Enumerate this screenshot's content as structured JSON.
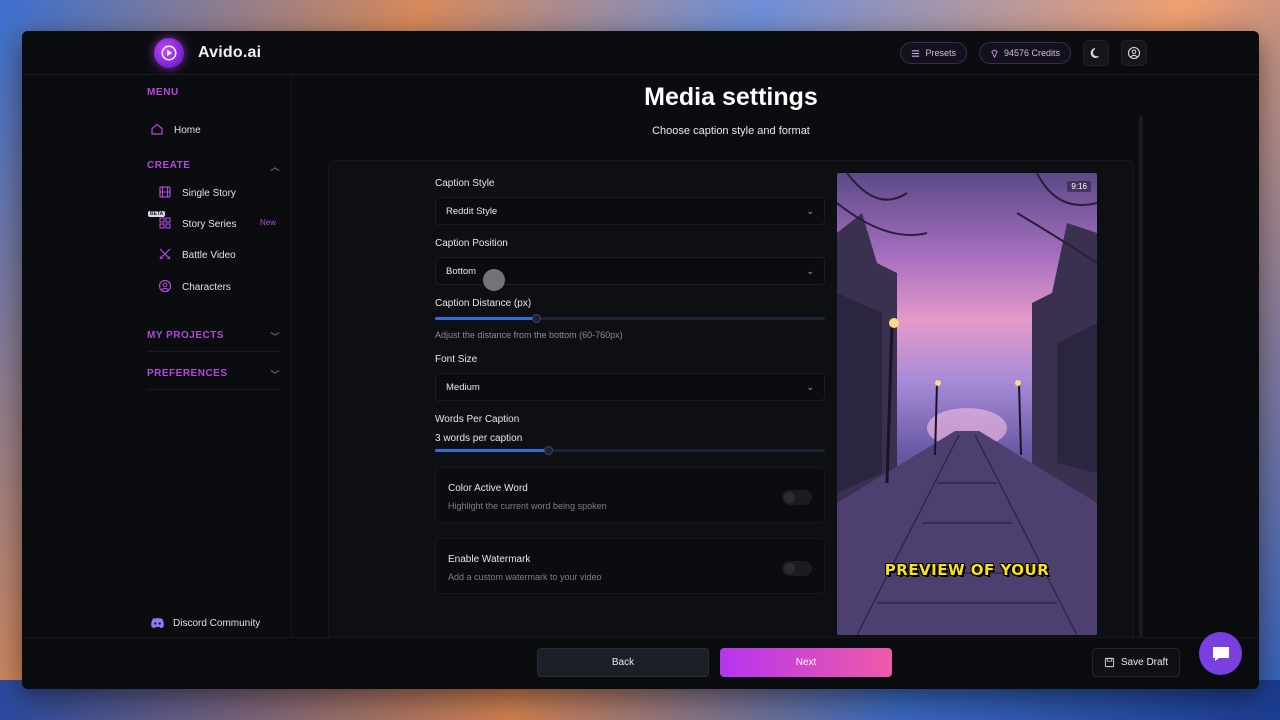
{
  "app": {
    "brand": "Avido.ai"
  },
  "topbar": {
    "presets_label": "Presets",
    "credits_label": "94576 Credits"
  },
  "sidebar": {
    "menu_label": "MENU",
    "home": "Home",
    "create_label": "CREATE",
    "items": [
      {
        "label": "Single Story"
      },
      {
        "label": "Story Series",
        "badge": "New",
        "tag": "BETA"
      },
      {
        "label": "Battle Video"
      },
      {
        "label": "Characters"
      }
    ],
    "my_projects_label": "MY PROJECTS",
    "preferences_label": "PREFERENCES",
    "discord_label": "Discord Community"
  },
  "page": {
    "title": "Media settings",
    "subtitle": "Choose caption style and format"
  },
  "form": {
    "caption_style": {
      "label": "Caption Style",
      "value": "Reddit Style"
    },
    "caption_position": {
      "label": "Caption Position",
      "value": "Bottom"
    },
    "caption_distance": {
      "label": "Caption Distance (px)",
      "hint": "Adjust the distance from the bottom (60-760px)",
      "fraction": 0.26
    },
    "font_size": {
      "label": "Font Size",
      "value": "Medium"
    },
    "words_per_caption": {
      "label": "Words Per Caption",
      "value_text": "3 words per caption",
      "fraction": 0.29
    },
    "color_active_word": {
      "title": "Color Active Word",
      "desc": "Highlight the current word being spoken",
      "enabled": false
    },
    "watermark": {
      "title": "Enable Watermark",
      "desc": "Add a custom watermark to your video",
      "enabled": false
    }
  },
  "preview": {
    "ratio": "9:16",
    "caption": "PREVIEW OF YOUR"
  },
  "footer": {
    "back": "Back",
    "next": "Next",
    "save_draft": "Save Draft"
  },
  "colors": {
    "accent": "#b04ad8",
    "next_start": "#b535f0",
    "next_end": "#ef5aa8",
    "slider": "#2e6fd8"
  }
}
